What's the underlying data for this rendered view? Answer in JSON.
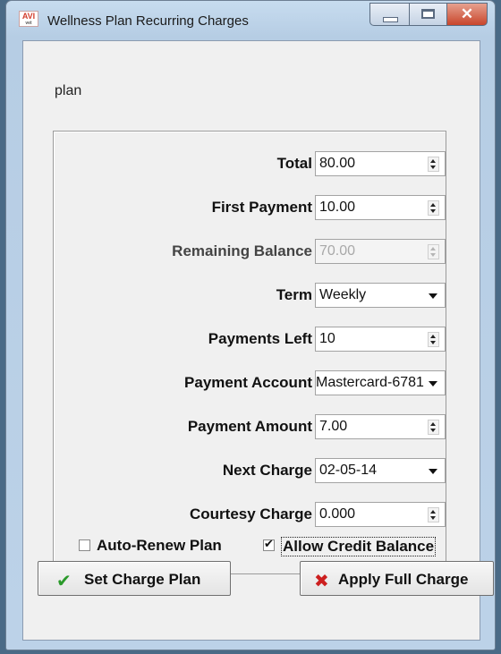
{
  "window": {
    "title": "Wellness Plan Recurring Charges",
    "icon_text": "AVI",
    "icon_subtext": "vet",
    "controls": {
      "minimize": "minimize-icon",
      "maximize": "maximize-icon",
      "close": "✕"
    }
  },
  "heading": "plan",
  "fields": [
    {
      "label": "Total",
      "value": "80.00",
      "control": "spinner",
      "enabled": true
    },
    {
      "label": "First Payment",
      "value": "10.00",
      "control": "spinner",
      "enabled": true
    },
    {
      "label": "Remaining Balance",
      "value": "70.00",
      "control": "spinner",
      "enabled": false
    },
    {
      "label": "Term",
      "value": "Weekly",
      "control": "dropdown",
      "enabled": true
    },
    {
      "label": "Payments Left",
      "value": "10",
      "control": "spinner",
      "enabled": true
    },
    {
      "label": "Payment Account",
      "value": "6781-Mastercard",
      "control": "dropdown",
      "enabled": true
    },
    {
      "label": "Payment Amount",
      "value": "7.00",
      "control": "spinner",
      "enabled": true
    },
    {
      "label": "Next Charge",
      "value": "02-05-14",
      "control": "dropdown",
      "enabled": true
    },
    {
      "label": "Courtesy Charge",
      "value": "0.000",
      "control": "spinner",
      "enabled": true
    }
  ],
  "checkboxes": {
    "auto_renew": {
      "label": "Auto-Renew Plan",
      "checked": false
    },
    "allow_credit": {
      "label": "Allow Credit Balance",
      "checked": true,
      "mark": "✔"
    }
  },
  "buttons": {
    "set_charge_plan": {
      "label": "Set Charge Plan",
      "icon": "✔",
      "icon_name": "checkmark-icon",
      "color": "#2b9a2b"
    },
    "apply_full_charge": {
      "label": "Apply Full Charge",
      "icon": "✖",
      "icon_name": "x-icon",
      "color": "#cc1f1f"
    }
  }
}
